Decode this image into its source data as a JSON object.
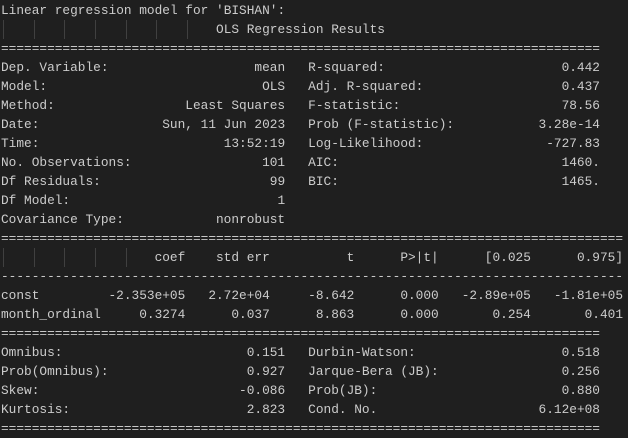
{
  "title": "Linear regression model for 'BISHAN':",
  "header": "OLS Regression Results",
  "summary": [
    {
      "left_label": "Dep. Variable:",
      "left_value": "mean",
      "right_label": "R-squared:",
      "right_value": "0.442"
    },
    {
      "left_label": "Model:",
      "left_value": "OLS",
      "right_label": "Adj. R-squared:",
      "right_value": "0.437"
    },
    {
      "left_label": "Method:",
      "left_value": "Least Squares",
      "right_label": "F-statistic:",
      "right_value": "78.56"
    },
    {
      "left_label": "Date:",
      "left_value": "Sun, 11 Jun 2023",
      "right_label": "Prob (F-statistic):",
      "right_value": "3.28e-14"
    },
    {
      "left_label": "Time:",
      "left_value": "13:52:19",
      "right_label": "Log-Likelihood:",
      "right_value": "-727.83"
    },
    {
      "left_label": "No. Observations:",
      "left_value": "101",
      "right_label": "AIC:",
      "right_value": "1460."
    },
    {
      "left_label": "Df Residuals:",
      "left_value": "99",
      "right_label": "BIC:",
      "right_value": "1465."
    },
    {
      "left_label": "Df Model:",
      "left_value": "1",
      "right_label": "",
      "right_value": ""
    },
    {
      "left_label": "Covariance Type:",
      "left_value": "nonrobust",
      "right_label": "",
      "right_value": ""
    }
  ],
  "coef_table": {
    "columns": [
      "coef",
      "std err",
      "t",
      "P>|t|",
      "[0.025",
      "0.975]"
    ],
    "rows": [
      {
        "name": "const",
        "values": [
          "-2.353e+05",
          "2.72e+04",
          "-8.642",
          "0.000",
          "-2.89e+05",
          "-1.81e+05"
        ]
      },
      {
        "name": "month_ordinal",
        "values": [
          "0.3274",
          "0.037",
          "8.863",
          "0.000",
          "0.254",
          "0.401"
        ]
      }
    ]
  },
  "diagnostics": [
    {
      "left_label": "Omnibus:",
      "left_value": "0.151",
      "right_label": "Durbin-Watson:",
      "right_value": "0.518"
    },
    {
      "left_label": "Prob(Omnibus):",
      "left_value": "0.927",
      "right_label": "Jarque-Bera (JB):",
      "right_value": "0.256"
    },
    {
      "left_label": "Skew:",
      "left_value": "-0.086",
      "right_label": "Prob(JB):",
      "right_value": "0.880"
    },
    {
      "left_label": "Kurtosis:",
      "left_value": "2.823",
      "right_label": "Cond. No.",
      "right_value": "6.12e+08"
    }
  ],
  "colors": {
    "background": "#1f1f1f",
    "text": "#cccccc",
    "indent_guide": "#404040"
  }
}
